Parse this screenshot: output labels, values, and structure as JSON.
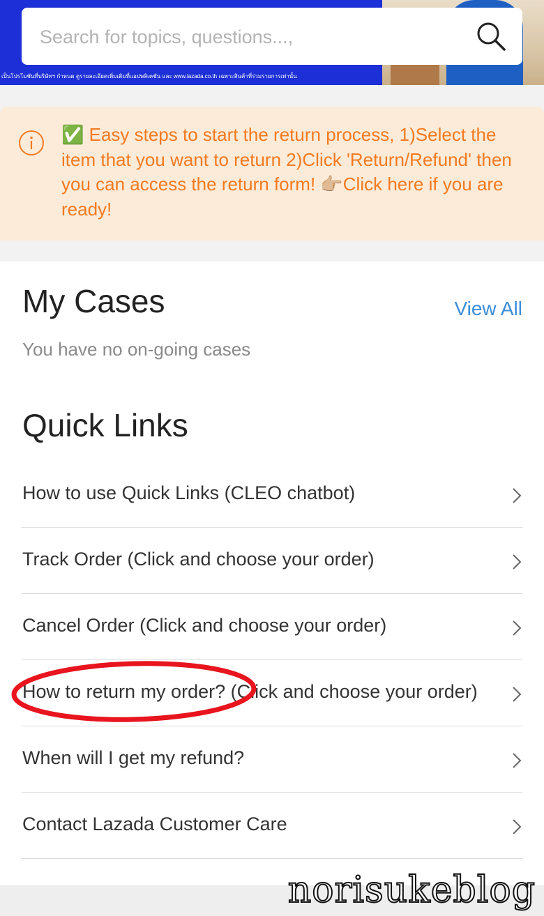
{
  "banner": {
    "fineprint": "เป็นโปรโมชันที่บริษัทฯ กำหนด ดูรายละเอียดเพิ่มเติมที่แอปพลิเคชัน และ www.lazada.co.th เฉพาะสินค้าที่ร่วมรายการเท่านั้น"
  },
  "search": {
    "placeholder": "Search for topics, questions...,",
    "icon": "search-icon"
  },
  "notice": {
    "text": "✅ Easy steps to start the return process, 1)Select the item that you want to return 2)Click 'Return/Refund' then you can access the return form! 👉🏼Click here if you are ready!",
    "color": "#f37a1f",
    "background": "#fcebd9"
  },
  "my_cases": {
    "title": "My Cases",
    "view_all": "View All",
    "empty_text": "You have no on-going cases"
  },
  "quick_links": {
    "title": "Quick Links",
    "items": [
      {
        "label": "How to use Quick Links (CLEO chatbot)"
      },
      {
        "label": "Track Order (Click and choose your order)"
      },
      {
        "label": "Cancel Order (Click and choose your order)"
      },
      {
        "label": "How to return my order? (Click and choose your order)"
      },
      {
        "label": "When will I get my refund?"
      },
      {
        "label": "Contact Lazada Customer Care"
      }
    ]
  },
  "watermark": {
    "text": "norisukeblog"
  },
  "colors": {
    "banner": "#1d2fd6",
    "link": "#3a8dd8",
    "annotation": "#e8141e"
  }
}
